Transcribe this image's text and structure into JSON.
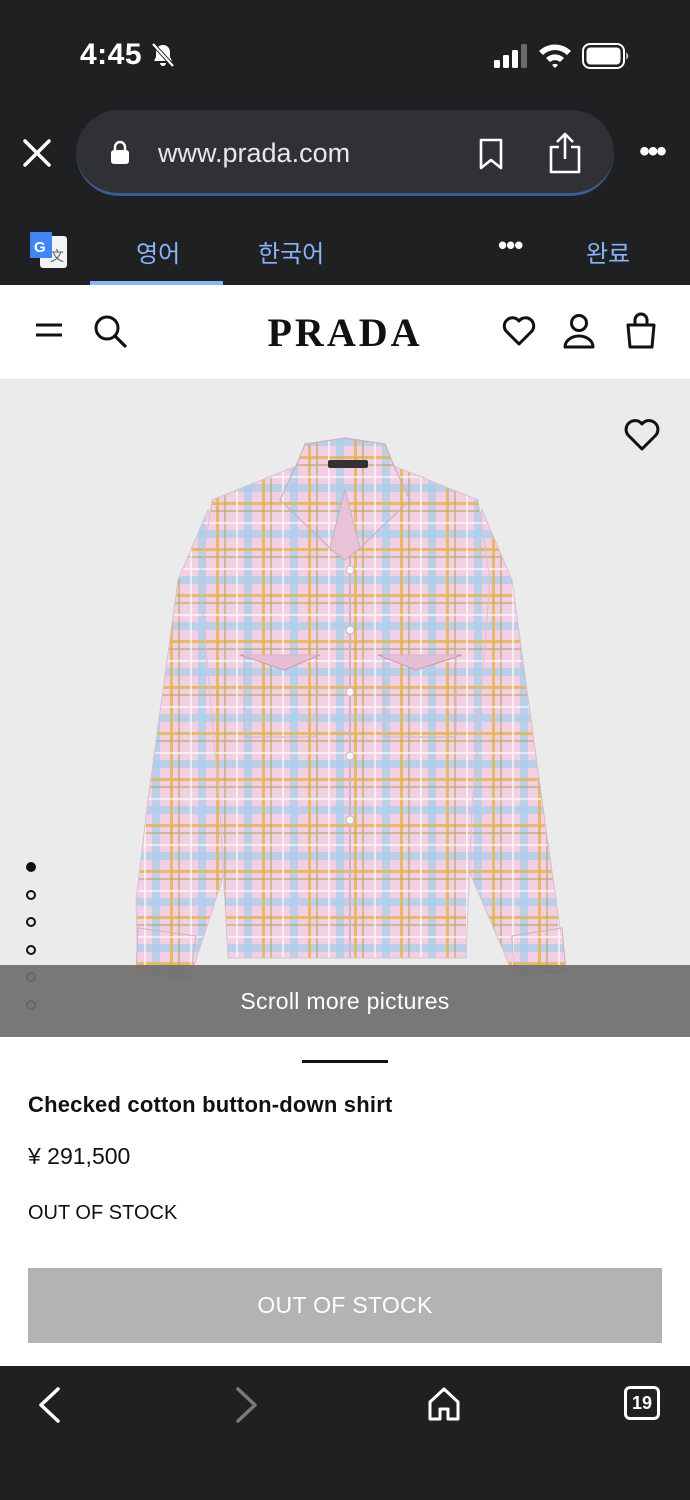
{
  "status_bar": {
    "time": "4:45"
  },
  "browser": {
    "url": "www.prada.com",
    "more": "•••"
  },
  "translate": {
    "tab_source": "영어",
    "tab_target": "한국어",
    "more": "•••",
    "done": "완료"
  },
  "site": {
    "logo": "PRADA"
  },
  "product": {
    "scroll_hint": "Scroll more pictures",
    "image_count": 6,
    "active_image": 1,
    "name": "Checked cotton button-down shirt",
    "price": "¥ 291,500",
    "stock_status": "OUT OF STOCK",
    "button_label": "OUT OF STOCK"
  },
  "bottom_nav": {
    "tab_count": "19"
  },
  "colors": {
    "chrome": "#1f2022",
    "accent": "#8ab4f8",
    "disabled_button": "#b3b3b3"
  }
}
